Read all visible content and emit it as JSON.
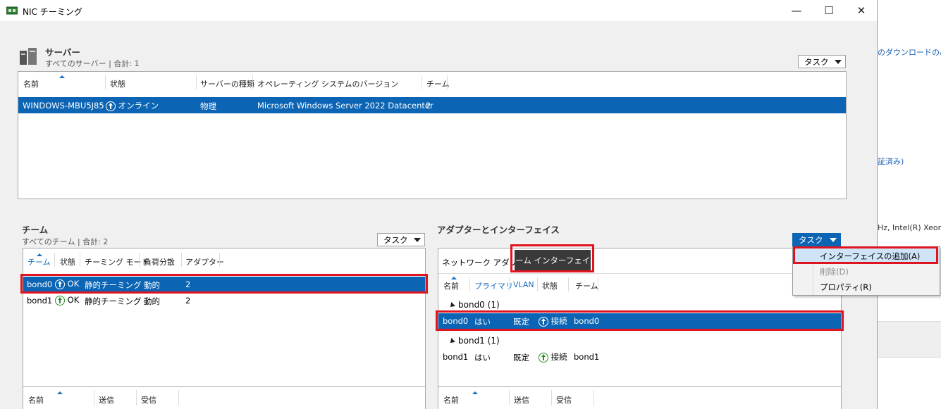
{
  "background_window": {
    "text_download": "のダウンロードのみを",
    "text_certified": "証済み)",
    "text_cpu": "Hz, Intel(R) Xeon"
  },
  "window": {
    "title": "NIC チーミング",
    "minimize_glyph": "—",
    "maximize_glyph": "☐",
    "close_glyph": "✕"
  },
  "servers": {
    "title": "サーバー",
    "subtitle": "すべてのサーバー | 合計: 1",
    "tasks_label": "タスク",
    "columns": [
      "名前",
      "状態",
      "サーバーの種類",
      "オペレーティング システムのバージョン",
      "チーム"
    ],
    "rows": [
      {
        "name": "WINDOWS-MBU5J85",
        "status": "オンライン",
        "type": "物理",
        "os": "Microsoft Windows Server 2022 Datacenter",
        "teams": "2"
      }
    ]
  },
  "teams": {
    "title": "チーム",
    "subtitle": "すべてのチーム | 合計: 2",
    "tasks_label": "タスク",
    "columns": [
      "チーム",
      "状態",
      "チーミング モード",
      "負荷分散",
      "アダプター"
    ],
    "rows": [
      {
        "team": "bond0",
        "status": "OK",
        "mode": "静的チーミング",
        "lb": "動的",
        "adapters": "2"
      },
      {
        "team": "bond1",
        "status": "OK",
        "mode": "静的チーミング",
        "lb": "動的",
        "adapters": "2"
      }
    ],
    "bottom_columns": [
      "名前",
      "送信",
      "受信"
    ]
  },
  "adapters": {
    "title": "アダプターとインターフェイス",
    "tasks_label": "タスク",
    "tabs": [
      "ネットワーク アダプター",
      "チーム インターフェイス"
    ],
    "columns": [
      "名前",
      "プライマリ",
      "VLAN",
      "状態",
      "チーム"
    ],
    "groups": [
      {
        "label": "bond0 (1)",
        "row": {
          "name": "bond0",
          "primary": "はい",
          "vlan": "既定",
          "status": "接続",
          "team": "bond0"
        }
      },
      {
        "label": "bond1 (1)",
        "row": {
          "name": "bond1",
          "primary": "はい",
          "vlan": "既定",
          "status": "接続",
          "team": "bond1"
        }
      }
    ],
    "bottom_columns": [
      "名前",
      "送信",
      "受信"
    ]
  },
  "context_menu": {
    "items": [
      {
        "label": "インターフェイスの追加(A)",
        "state": "hover"
      },
      {
        "label": "削除(D)",
        "state": "disabled"
      },
      {
        "label": "プロパティ(R)",
        "state": "normal"
      }
    ]
  },
  "colors": {
    "selection": "#0b64b4",
    "highlight_box": "#e0141e",
    "status_green": "#2e8b2e",
    "menu_hover": "#cfe4f7"
  }
}
